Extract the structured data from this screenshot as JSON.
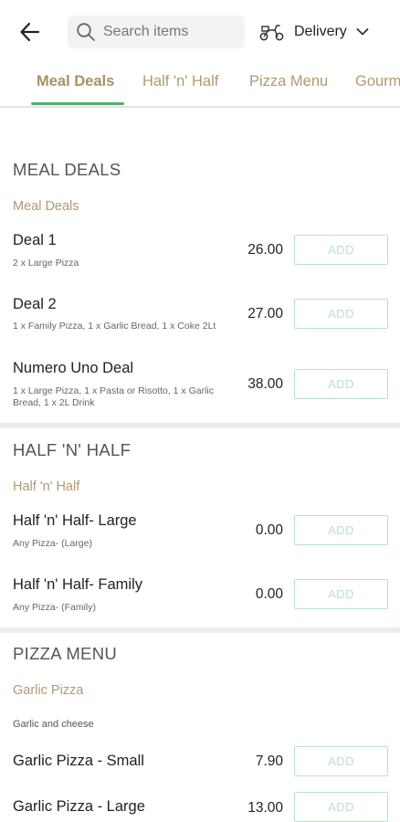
{
  "header": {
    "search_placeholder": "Search items",
    "order_mode": "Delivery"
  },
  "tabs": [
    {
      "label": "Meal Deals",
      "active": true
    },
    {
      "label": "Half 'n' Half",
      "active": false
    },
    {
      "label": "Pizza Menu",
      "active": false
    },
    {
      "label": "Gourm",
      "active": false
    }
  ],
  "sections": [
    {
      "title": "MEAL DEALS",
      "category": "Meal Deals",
      "items": [
        {
          "name": "Deal 1",
          "desc": "2 x Large Pizza",
          "price": "26.00",
          "button": "ADD"
        },
        {
          "name": "Deal 2",
          "desc": "1 x Family Pizza, 1 x Garlic Bread, 1 x Coke 2Lt",
          "price": "27.00",
          "button": "ADD"
        },
        {
          "name": "Numero Uno Deal",
          "desc": "1 x Large Pizza, 1 x Pasta or Risotto, 1 x Garlic Bread, 1 x 2L Drink",
          "price": "38.00",
          "button": "ADD"
        }
      ]
    },
    {
      "title": "HALF 'N' HALF",
      "category": "Half 'n' Half",
      "items": [
        {
          "name": "Half 'n' Half- Large",
          "desc": "Any Pizza- (Large)",
          "price": "0.00",
          "button": "ADD"
        },
        {
          "name": "Half 'n' Half- Family",
          "desc": "Any Pizza- (Family)",
          "price": "0.00",
          "button": "ADD"
        }
      ]
    },
    {
      "title": "PIZZA MENU",
      "category": "Garlic Pizza",
      "category_desc": "Garlic and cheese",
      "items": [
        {
          "name": "Garlic Pizza - Small",
          "price": "7.90",
          "button": "ADD"
        },
        {
          "name": "Garlic Pizza - Large",
          "price": "13.00",
          "button": "ADD"
        }
      ]
    }
  ],
  "icons": {
    "back": "arrow-left-icon",
    "search": "search-icon",
    "delivery": "scooter-icon",
    "dropdown": "chevron-down-icon"
  },
  "colors": {
    "accent_green": "#4caf6e",
    "gold_text": "#b09a6d",
    "button_border": "#b9e2c7"
  }
}
